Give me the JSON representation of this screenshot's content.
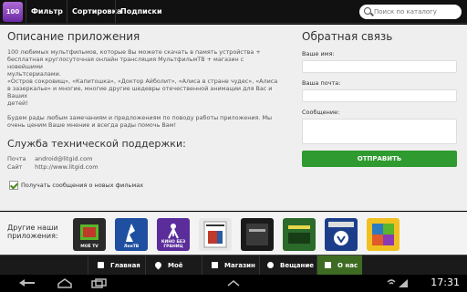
{
  "topbar": {
    "app_badge": "100",
    "tabs": [
      "Фильтр",
      "Сортировка",
      "Подписки"
    ],
    "search_placeholder": "Поиск по каталогу"
  },
  "description": {
    "title": "Описание приложения",
    "text": "100 любимых мультфильмов, которые Вы можете скачать в память устройства +\nбесплатная круглосуточная онлайн трансляция МультфильмТВ + магазин с новейшими\nмультсериалами.\n«Остров сокровищ», «Капитошка», «Доктор Айболит», «Алиса в стране чудес», «Алиса\nв зазеркалье» и многие, многие другие шедевры отечественной анимации для Вас и Ваших\nдетей!\n\nБудем рады любым замечаниям и предложениям по поводу работы приложения. Мы\nочень ценим Ваше мнение и всегда рады помочь Вам!"
  },
  "support": {
    "title": "Служба технической поддержки:",
    "mail_label": "Почта",
    "mail_value": "android@litgid.com",
    "site_label": "Сайт",
    "site_value": "http://www.litgid.com",
    "checkbox_label": "Получать сообщения о новых фильмах"
  },
  "feedback": {
    "title": "Обратная связь",
    "name_label": "Ваше имя:",
    "email_label": "Ваша почта:",
    "message_label": "Сообщение:",
    "send_label": "ОТПРАВИТЬ"
  },
  "other_apps": {
    "label": "Другие наши приложения:",
    "tiles": [
      {
        "text": "МОЁ TV",
        "color": "#2a2a2a"
      },
      {
        "text": "ЛенТВ",
        "color": "#1e4fa0"
      },
      {
        "text": "КИНО БЕЗ ГРАНИЦ",
        "color": "#5a2d9a"
      },
      {
        "text": "",
        "color": "#e8e8e8"
      },
      {
        "text": "",
        "color": "#1a1a1a"
      },
      {
        "text": "",
        "color": "#2b6a2b"
      },
      {
        "text": "",
        "color": "#1c3e8a"
      },
      {
        "text": "",
        "color": "#f0c020"
      }
    ]
  },
  "nav": {
    "items": [
      "Главная",
      "Моё",
      "Магазин",
      "Вещание",
      "О нас"
    ],
    "active": "О нас",
    "active_color": "#3e6b22"
  },
  "system": {
    "time": "17:31"
  }
}
